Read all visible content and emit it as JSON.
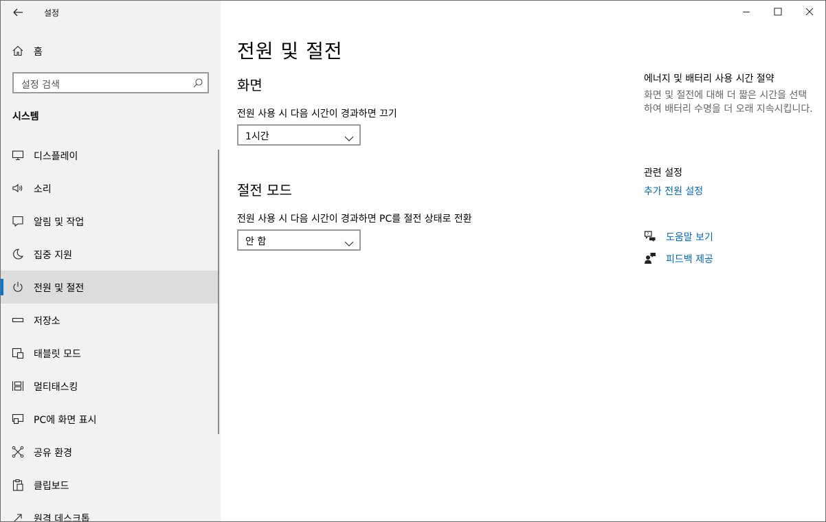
{
  "app": {
    "title": "설정"
  },
  "sidebar": {
    "home_label": "홈",
    "search_placeholder": "설정 검색",
    "section_label": "시스템",
    "items": [
      {
        "label": "디스플레이",
        "icon": "monitor-icon"
      },
      {
        "label": "소리",
        "icon": "speaker-icon"
      },
      {
        "label": "알림 및 작업",
        "icon": "notification-icon"
      },
      {
        "label": "집중 지원",
        "icon": "moon-icon"
      },
      {
        "label": "전원 및 절전",
        "icon": "power-icon",
        "active": true
      },
      {
        "label": "저장소",
        "icon": "storage-icon"
      },
      {
        "label": "태블릿 모드",
        "icon": "tablet-icon"
      },
      {
        "label": "멀티태스킹",
        "icon": "multitasking-icon"
      },
      {
        "label": "PC에 화면 표시",
        "icon": "project-icon"
      },
      {
        "label": "공유 환경",
        "icon": "share-icon"
      },
      {
        "label": "클립보드",
        "icon": "clipboard-icon"
      },
      {
        "label": "원격 데스크톱",
        "icon": "remote-desktop-icon"
      }
    ]
  },
  "main": {
    "page_title": "전원 및 절전",
    "screen": {
      "heading": "화면",
      "label": "전원 사용 시 다음 시간이 경과하면 끄기",
      "value": "1시간"
    },
    "sleep": {
      "heading": "절전 모드",
      "label": "전원 사용 시 다음 시간이 경과하면 PC를 절전 상태로 전환",
      "value": "안 함"
    }
  },
  "aside": {
    "title": "에너지 및 배터리 사용 시간 절약",
    "description": "화면 및 절전에 대해 더 짧은 시간을 선택하여 배터리 수명을 더 오래 지속시킵니다.",
    "related_heading": "관련 설정",
    "related_link": "추가 전원 설정",
    "help_label": "도움말 보기",
    "feedback_label": "피드백 제공"
  },
  "colors": {
    "accent": "#0078d7",
    "link": "#0067c0",
    "sidebar_bg": "#f2f2f2",
    "active_bg": "#dcdcdc"
  }
}
